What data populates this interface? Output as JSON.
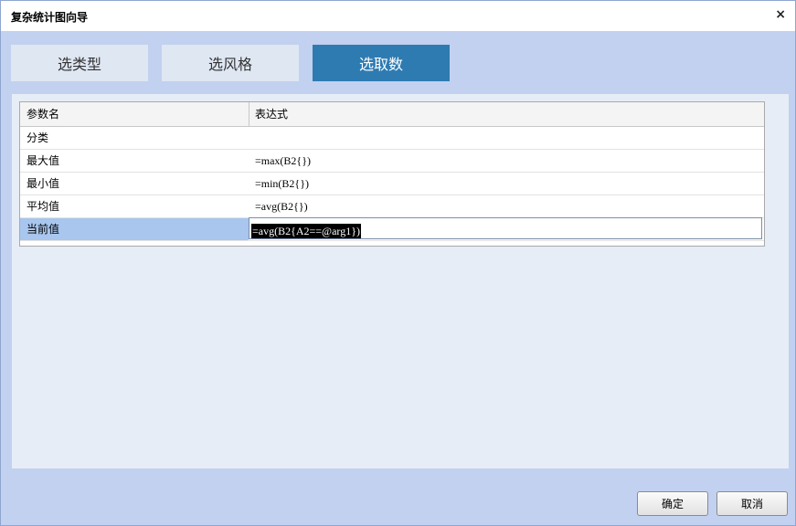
{
  "dialog": {
    "title": "复杂统计图向导",
    "close_glyph": "×"
  },
  "tabs": [
    {
      "label": "选类型",
      "active": false
    },
    {
      "label": "选风格",
      "active": false
    },
    {
      "label": "选取数",
      "active": true
    }
  ],
  "grid": {
    "columns": [
      "参数名",
      "表达式"
    ],
    "rows": [
      {
        "name": "分类",
        "expression": ""
      },
      {
        "name": "最大值",
        "expression": "=max(B2{})"
      },
      {
        "name": "最小值",
        "expression": "=min(B2{})"
      },
      {
        "name": "平均值",
        "expression": "=avg(B2{})"
      },
      {
        "name": "当前值",
        "expression": "=avg(B2{A2==@arg1})",
        "selected": true,
        "editing": true
      }
    ]
  },
  "footer": {
    "ok_label": "确定",
    "cancel_label": "取消"
  },
  "colors": {
    "active_tab": "#2e7bb2",
    "inactive_tab": "#dfe7f3",
    "dialog_bg": "#c1d1ef",
    "selected_row": "#a8c6ee"
  }
}
